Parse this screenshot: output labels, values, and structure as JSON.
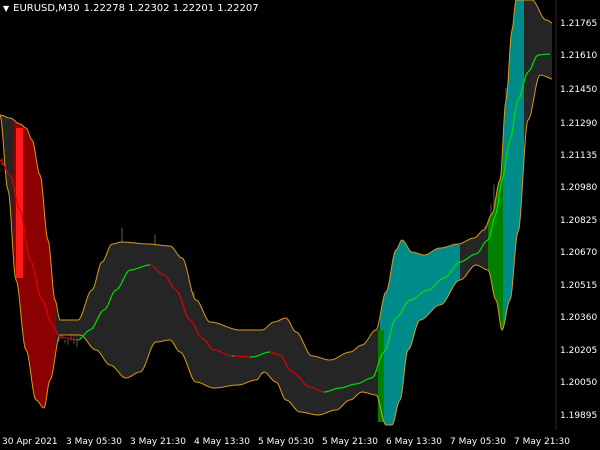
{
  "header": {
    "symbol": "EURUSD,M30",
    "quote": "1.22278 1.22302 1.22201 1.22207"
  },
  "price_axis": {
    "labels": [
      "1.21765",
      "1.21610",
      "1.21450",
      "1.21290",
      "1.21135",
      "1.20980",
      "1.20825",
      "1.20670",
      "1.20515",
      "1.20360",
      "1.20205",
      "1.20050",
      "1.19895"
    ]
  },
  "time_axis": {
    "labels": [
      "30 Apr 2021",
      "3 May 05:30",
      "3 May 21:30",
      "4 May 13:30",
      "5 May 05:30",
      "5 May 21:30",
      "6 May 13:30",
      "7 May 05:30",
      "7 May 21:30"
    ]
  },
  "colors": {
    "background": "#000000",
    "band_fill": "#262626",
    "band_edge": "#d89a1a",
    "bear_fill": "#8b0000",
    "bear_bar": "#ff1a1a",
    "bull_fill": "#008b8b",
    "bull_bar": "#008000",
    "line_up": "#00e000",
    "line_down": "#e00000",
    "text": "#ffffff"
  }
}
